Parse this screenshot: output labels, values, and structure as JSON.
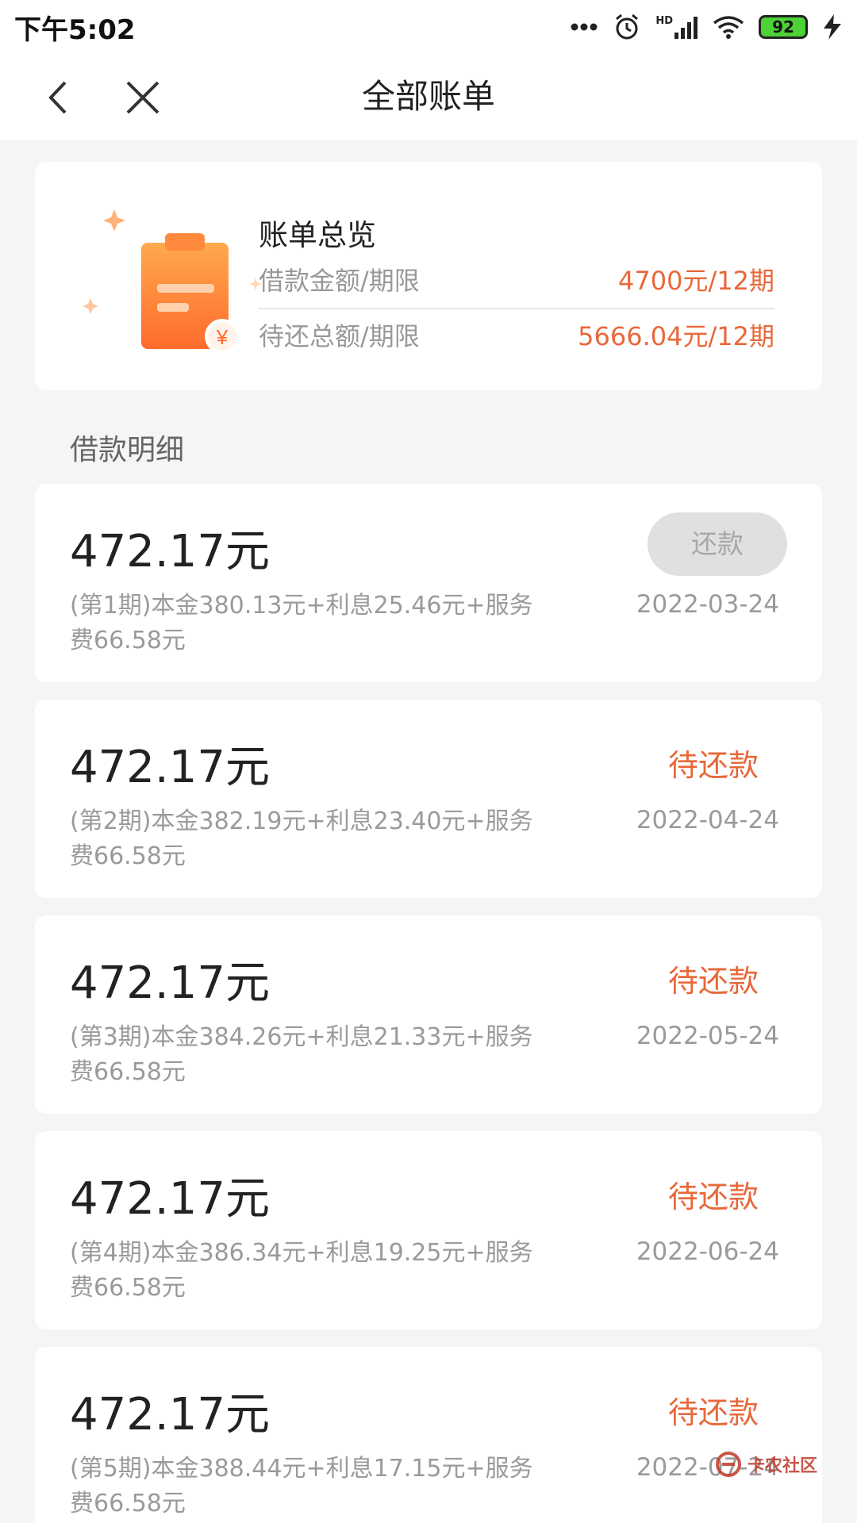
{
  "status_bar": {
    "time": "下午5:02",
    "battery": "92",
    "network": "HD"
  },
  "nav": {
    "title": "全部账单"
  },
  "overview": {
    "title": "账单总览",
    "loan_label": "借款金额/期限",
    "loan_value": "4700元/12期",
    "due_label": "待还总额/期限",
    "due_value": "5666.04元/12期",
    "currency_badge": "¥"
  },
  "section_title": "借款明细",
  "bills": [
    {
      "amount": "472.17元",
      "detail": "(第1期)本金380.13元+利息25.46元+服务费66.58元",
      "date": "2022-03-24",
      "action": "还款"
    },
    {
      "amount": "472.17元",
      "detail": "(第2期)本金382.19元+利息23.40元+服务费66.58元",
      "date": "2022-04-24",
      "status": "待还款"
    },
    {
      "amount": "472.17元",
      "detail": "(第3期)本金384.26元+利息21.33元+服务费66.58元",
      "date": "2022-05-24",
      "status": "待还款"
    },
    {
      "amount": "472.17元",
      "detail": "(第4期)本金386.34元+利息19.25元+服务费66.58元",
      "date": "2022-06-24",
      "status": "待还款"
    },
    {
      "amount": "472.17元",
      "detail": "(第5期)本金388.44元+利息17.15元+服务费66.58元",
      "date": "2022-07-24",
      "status": "待还款"
    }
  ],
  "watermark": "卡农社区",
  "colors": {
    "accent": "#e8683a",
    "muted": "#9a9a9a",
    "background": "#f5f5f5"
  }
}
